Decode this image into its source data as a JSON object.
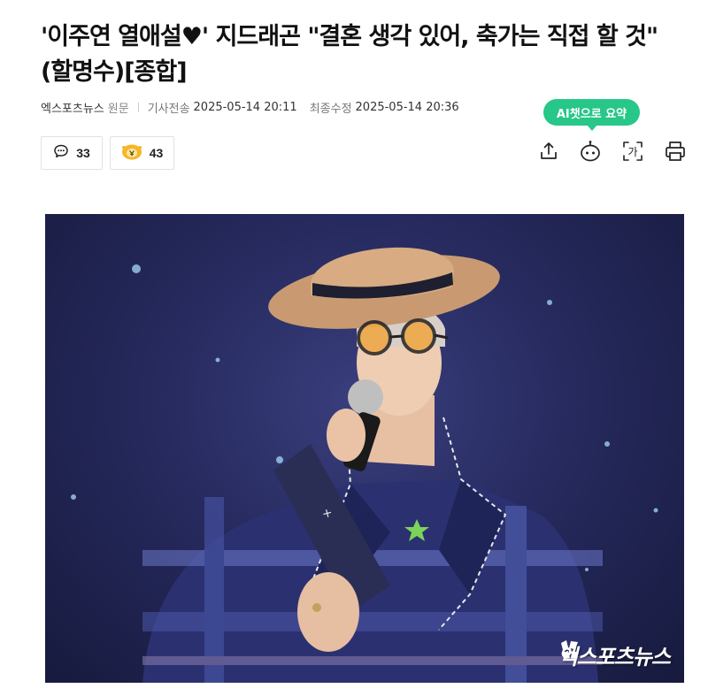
{
  "article": {
    "headline": "'이주연 열애설♥' 지드래곤 \"결혼 생각 있어, 축가는 직접 할 것\" (할명수)[종합]"
  },
  "meta": {
    "press": "엑스포츠뉴스",
    "origin_link": "원문",
    "sent_label": "기사전송",
    "sent_time": "2025-05-14 20:11",
    "modified_label": "최종수정",
    "modified_time": "2025-05-14 20:36"
  },
  "reactions": {
    "comment_count": "33",
    "reaction_count": "43"
  },
  "toolbar": {
    "ai_summary_label": "AI챗으로 요약",
    "font_size_glyph": "가",
    "items": [
      "share-icon",
      "ai-bot-icon",
      "font-size-icon",
      "print-icon"
    ]
  },
  "photo": {
    "watermark": "엑스포츠뉴스"
  },
  "colors": {
    "ai_badge": "#27c789",
    "stage_bg": "#262a5e"
  }
}
